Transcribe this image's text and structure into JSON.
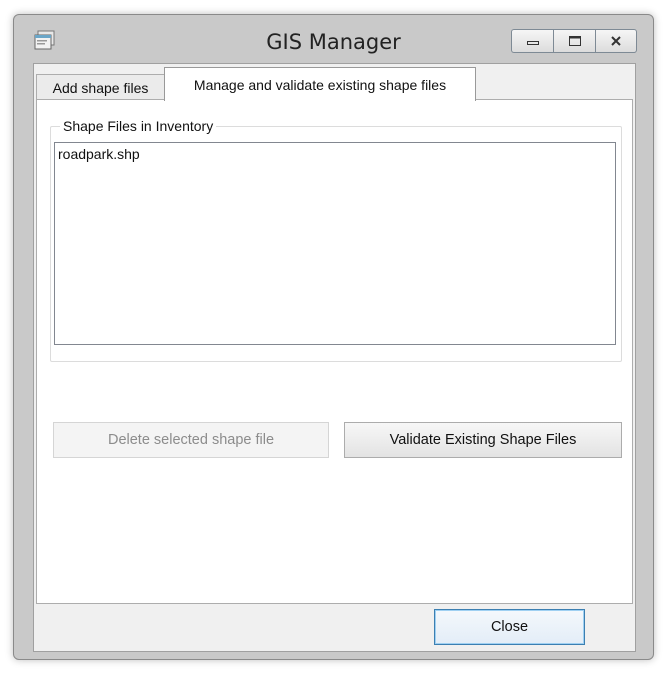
{
  "window": {
    "title": "GIS Manager",
    "icon": "app-window-icon",
    "controls": [
      "minimize-icon",
      "maximize-icon",
      "close-icon"
    ]
  },
  "tabs": [
    {
      "label": "Add shape files",
      "active": false
    },
    {
      "label": "Manage and validate existing shape files",
      "active": true
    }
  ],
  "inventory": {
    "group_label": "Shape Files in Inventory",
    "items": [
      "roadpark.shp"
    ]
  },
  "buttons": {
    "delete_label": "Delete selected shape file",
    "validate_label": "Validate Existing Shape Files",
    "close_label": "Close"
  },
  "colors": {
    "window_frame": "#c9c9c9",
    "client_bg": "#f0f0f0",
    "default_button_border": "#3c7fb1"
  }
}
